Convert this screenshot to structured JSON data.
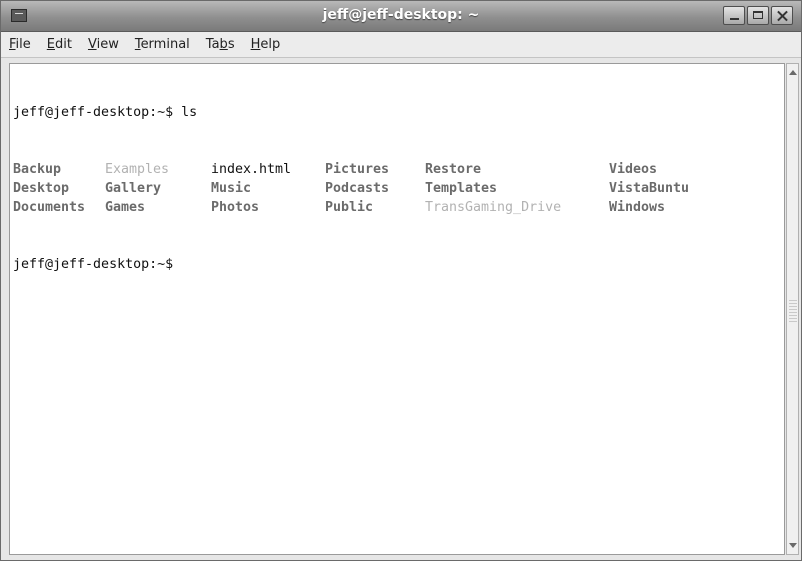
{
  "window": {
    "title": "jeff@jeff-desktop: ~",
    "buttons": {
      "minimize": "minimize",
      "maximize": "maximize",
      "close": "close"
    }
  },
  "menu": [
    {
      "pre": "",
      "mn": "F",
      "post": "ile"
    },
    {
      "pre": "",
      "mn": "E",
      "post": "dit"
    },
    {
      "pre": "",
      "mn": "V",
      "post": "iew"
    },
    {
      "pre": "",
      "mn": "T",
      "post": "erminal"
    },
    {
      "pre": "Ta",
      "mn": "b",
      "post": "s"
    },
    {
      "pre": "",
      "mn": "H",
      "post": "elp"
    }
  ],
  "terminal": {
    "prompt": "jeff@jeff-desktop:~$",
    "command": "ls",
    "listing": [
      [
        {
          "name": "Backup",
          "style": "dir"
        },
        {
          "name": "Examples",
          "style": "light"
        },
        {
          "name": "index.html",
          "style": "file"
        },
        {
          "name": "Pictures",
          "style": "dir"
        },
        {
          "name": "Restore",
          "style": "dir"
        },
        {
          "name": "Videos",
          "style": "dir"
        }
      ],
      [
        {
          "name": "Desktop",
          "style": "dir"
        },
        {
          "name": "Gallery",
          "style": "dir"
        },
        {
          "name": "Music",
          "style": "dir"
        },
        {
          "name": "Podcasts",
          "style": "dir"
        },
        {
          "name": "Templates",
          "style": "dir"
        },
        {
          "name": "VistaBuntu",
          "style": "dir"
        }
      ],
      [
        {
          "name": "Documents",
          "style": "dir"
        },
        {
          "name": "Games",
          "style": "dir"
        },
        {
          "name": "Photos",
          "style": "dir"
        },
        {
          "name": "Public",
          "style": "dir"
        },
        {
          "name": "TransGaming_Drive",
          "style": "light"
        },
        {
          "name": "Windows",
          "style": "dir"
        }
      ]
    ],
    "final_prompt": "jeff@jeff-desktop:~$"
  },
  "colors": {
    "directory": "#6b6b6b",
    "symlink_light": "#b2b2b2",
    "file": "#111111",
    "background": "#ffffff"
  }
}
